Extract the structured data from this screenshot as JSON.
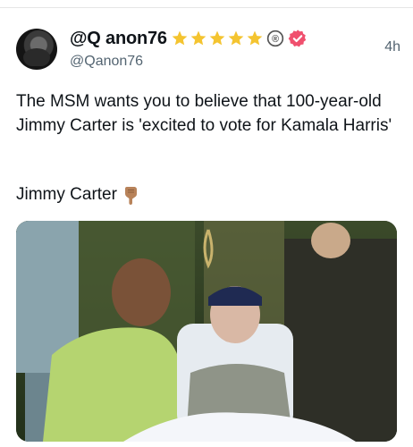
{
  "post": {
    "display_name": "@Q anon76",
    "handle": "@Qanon76",
    "time": "4h",
    "badges": {
      "stars": 5,
      "star_color": "#f4c430",
      "registered": "®",
      "verified_color": "#f0506e"
    },
    "text": "The MSM wants you to believe that 100-year-old Jimmy Carter is 'excited to vote for Kamala Harris'",
    "author_line": "Jimmy Carter",
    "author_icon": "pointing-down-hand-icon",
    "media": {
      "icon": "photo"
    }
  }
}
